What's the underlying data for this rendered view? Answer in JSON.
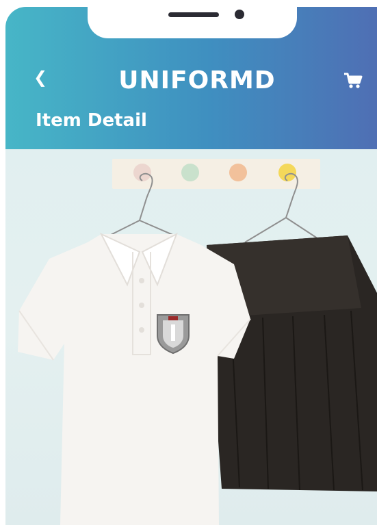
{
  "header": {
    "app_title": "UNIFORMD",
    "page_title": "Item Detail",
    "back_icon": "chevron-left-icon",
    "cart_icon": "shopping-cart-icon",
    "gradient": [
      "#47b6c7",
      "#4f6fb4"
    ]
  },
  "product": {
    "image": "school-uniform-photo",
    "items": [
      "white-polo-shirt",
      "black-pleated-skirt"
    ]
  }
}
